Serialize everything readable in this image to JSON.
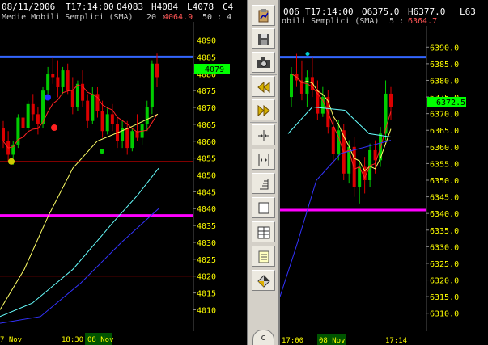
{
  "left_chart": {
    "header_date": "08/11/2006",
    "header_time": "T17:14:00",
    "header_open": "O4083",
    "header_high": "H4084",
    "header_low": "L4078",
    "header_close_cut": "C4",
    "ma_title": "Medie Mobili Semplici (SMA)",
    "ma_period": "20 :",
    "ma_value": "4064.9",
    "ma_period2": "50 : 4",
    "price_tag": "4079",
    "price_ticks": [
      "4090",
      "4085",
      "4080",
      "4075",
      "4070",
      "4065",
      "4060",
      "4055",
      "4050",
      "4045",
      "4040",
      "4035",
      "4030",
      "4025",
      "4020",
      "4015",
      "4010"
    ],
    "time_labels": [
      "7 Nov",
      "18:30",
      "08 Nov"
    ],
    "chart_data": {
      "type": "candlestick",
      "y_unit": "price",
      "ylim": [
        4007,
        4093
      ],
      "current_price": 4079,
      "resistance_level": 4085,
      "support_level": 4038,
      "red_levels": [
        4054,
        4020
      ],
      "sma_20_last": 4064.9,
      "candles": [
        {
          "o": 4064,
          "h": 4066,
          "l": 4058,
          "c": 4060
        },
        {
          "o": 4060,
          "h": 4063,
          "l": 4054,
          "c": 4056
        },
        {
          "o": 4056,
          "h": 4060,
          "l": 4053,
          "c": 4059
        },
        {
          "o": 4059,
          "h": 4068,
          "l": 4058,
          "c": 4067
        },
        {
          "o": 4067,
          "h": 4070,
          "l": 4062,
          "c": 4064
        },
        {
          "o": 4064,
          "h": 4072,
          "l": 4063,
          "c": 4071
        },
        {
          "o": 4071,
          "h": 4074,
          "l": 4066,
          "c": 4068
        },
        {
          "o": 4068,
          "h": 4070,
          "l": 4062,
          "c": 4065
        },
        {
          "o": 4065,
          "h": 4076,
          "l": 4064,
          "c": 4075
        },
        {
          "o": 4075,
          "h": 4082,
          "l": 4074,
          "c": 4080
        },
        {
          "o": 4080,
          "h": 4085,
          "l": 4077,
          "c": 4079
        },
        {
          "o": 4079,
          "h": 4084,
          "l": 4073,
          "c": 4076
        },
        {
          "o": 4076,
          "h": 4082,
          "l": 4074,
          "c": 4081
        },
        {
          "o": 4081,
          "h": 4083,
          "l": 4074,
          "c": 4075
        },
        {
          "o": 4075,
          "h": 4079,
          "l": 4068,
          "c": 4070
        },
        {
          "o": 4070,
          "h": 4078,
          "l": 4069,
          "c": 4077
        },
        {
          "o": 4077,
          "h": 4081,
          "l": 4070,
          "c": 4072
        },
        {
          "o": 4072,
          "h": 4074,
          "l": 4064,
          "c": 4066
        },
        {
          "o": 4066,
          "h": 4076,
          "l": 4065,
          "c": 4074
        },
        {
          "o": 4074,
          "h": 4076,
          "l": 4067,
          "c": 4069
        },
        {
          "o": 4069,
          "h": 4072,
          "l": 4061,
          "c": 4063
        },
        {
          "o": 4063,
          "h": 4070,
          "l": 4062,
          "c": 4068
        },
        {
          "o": 4068,
          "h": 4071,
          "l": 4063,
          "c": 4065
        },
        {
          "o": 4065,
          "h": 4067,
          "l": 4058,
          "c": 4060
        },
        {
          "o": 4060,
          "h": 4066,
          "l": 4058,
          "c": 4064
        },
        {
          "o": 4064,
          "h": 4066,
          "l": 4056,
          "c": 4058
        },
        {
          "o": 4058,
          "h": 4064,
          "l": 4057,
          "c": 4063
        },
        {
          "o": 4063,
          "h": 4068,
          "l": 4060,
          "c": 4061
        },
        {
          "o": 4061,
          "h": 4066,
          "l": 4059,
          "c": 4065
        },
        {
          "o": 4065,
          "h": 4072,
          "l": 4063,
          "c": 4070
        },
        {
          "o": 4070,
          "h": 4084,
          "l": 4068,
          "c": 4083
        },
        {
          "o": 4083,
          "h": 4086,
          "l": 4076,
          "c": 4079
        }
      ]
    }
  },
  "right_chart": {
    "header_date": "006",
    "header_time": "T17:14:00",
    "header_open": "O6375.0",
    "header_high": "H6377.0",
    "header_low": "L63",
    "ma_title": "obili Semplici (SMA)",
    "ma_period": "5 :",
    "ma_value": "6364.7",
    "price_tag": "6372.5",
    "price_ticks": [
      "6390.0",
      "6385.0",
      "6380.0",
      "6375.0",
      "6370.0",
      "6365.0",
      "6360.0",
      "6355.0",
      "6350.0",
      "6345.0",
      "6340.0",
      "6335.0",
      "6330.0",
      "6325.0",
      "6320.0",
      "6315.0",
      "6310.0"
    ],
    "time_labels": [
      "17:00",
      "08 Nov",
      "17:14"
    ],
    "chart_data": {
      "type": "candlestick",
      "y_unit": "price",
      "ylim": [
        6307.5,
        6392.5
      ],
      "current_price": 6372.5,
      "resistance_level": 6387,
      "support_level": 6341,
      "red_levels": [
        6320
      ],
      "sma_5_last": 6364.7,
      "candles": [
        {
          "o": 6375,
          "h": 6384,
          "l": 6372,
          "c": 6382
        },
        {
          "o": 6382,
          "h": 6388,
          "l": 6378,
          "c": 6380
        },
        {
          "o": 6380,
          "h": 6386,
          "l": 6374,
          "c": 6376
        },
        {
          "o": 6376,
          "h": 6383,
          "l": 6372,
          "c": 6381
        },
        {
          "o": 6381,
          "h": 6387,
          "l": 6375,
          "c": 6377
        },
        {
          "o": 6377,
          "h": 6380,
          "l": 6368,
          "c": 6370
        },
        {
          "o": 6370,
          "h": 6378,
          "l": 6369,
          "c": 6375
        },
        {
          "o": 6375,
          "h": 6377,
          "l": 6364,
          "c": 6366
        },
        {
          "o": 6366,
          "h": 6369,
          "l": 6355,
          "c": 6358
        },
        {
          "o": 6358,
          "h": 6368,
          "l": 6356,
          "c": 6365
        },
        {
          "o": 6365,
          "h": 6367,
          "l": 6350,
          "c": 6352
        },
        {
          "o": 6352,
          "h": 6362,
          "l": 6349,
          "c": 6360
        },
        {
          "o": 6360,
          "h": 6363,
          "l": 6345,
          "c": 6348
        },
        {
          "o": 6348,
          "h": 6356,
          "l": 6343,
          "c": 6354
        },
        {
          "o": 6354,
          "h": 6357,
          "l": 6346,
          "c": 6350
        },
        {
          "o": 6350,
          "h": 6361,
          "l": 6348,
          "c": 6359
        },
        {
          "o": 6359,
          "h": 6362,
          "l": 6352,
          "c": 6356
        },
        {
          "o": 6356,
          "h": 6366,
          "l": 6354,
          "c": 6364
        },
        {
          "o": 6364,
          "h": 6380,
          "l": 6362,
          "c": 6376
        },
        {
          "o": 6376,
          "h": 6378,
          "l": 6368,
          "c": 6372
        }
      ]
    }
  },
  "toolbar": {
    "items": [
      {
        "name": "paste-chart-icon",
        "label": "Incolla"
      },
      {
        "name": "save-icon",
        "label": "Salva"
      },
      {
        "name": "camera-icon",
        "label": "Foto"
      },
      {
        "name": "rewind-icon",
        "label": "Indietro"
      },
      {
        "name": "fast-forward-icon",
        "label": "Avanti"
      },
      {
        "name": "zoom-in-icon",
        "label": "Zoom +"
      },
      {
        "name": "zoom-out-icon",
        "label": "Zoom -"
      },
      {
        "name": "volume-bars-icon",
        "label": "Volumi"
      },
      {
        "name": "box-icon",
        "label": "Cornice"
      },
      {
        "name": "grid-icon",
        "label": "Griglia"
      },
      {
        "name": "list-icon",
        "label": "Elenco"
      },
      {
        "name": "color-picker-icon",
        "label": "Colori"
      }
    ],
    "scroll_label": "c"
  },
  "colors": {
    "background": "#000000",
    "bull_candle": "#00cc00",
    "bear_candle": "#dd0000",
    "tag_bg": "#00ff00",
    "resistance_line": "#3366ff",
    "support_line": "#ff00ff",
    "red_level": "#aa0000",
    "sma_short": "#ffff66",
    "sma_mid": "#66ffff",
    "sma_long": "#3333ff",
    "sma_red": "#ff2222",
    "axis_text": "#ffff00",
    "time_bar_bg": "#005500",
    "toolbar_bg": "#d4d0c8"
  }
}
